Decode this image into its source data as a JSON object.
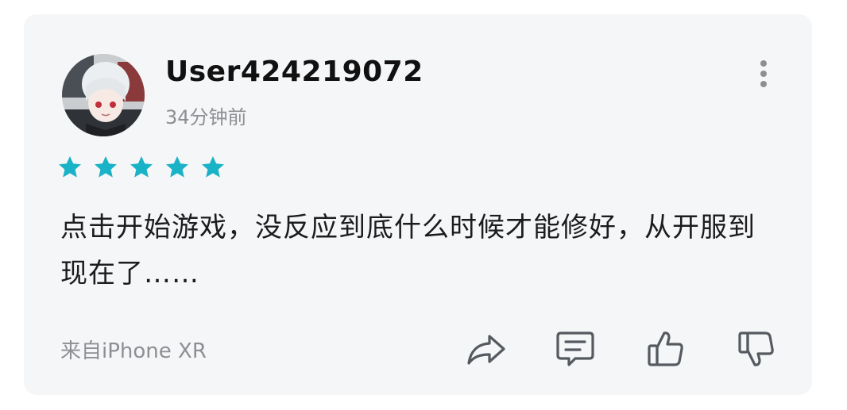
{
  "review": {
    "username": "User424219072",
    "time_ago": "34分钟前",
    "rating": 5,
    "rating_max": 5,
    "star_color": "#1ab2c6",
    "text": "点击开始游戏，没反应到底什么时候才能修好，从开服到现在了……",
    "source": "来自iPhone XR"
  },
  "icons": {
    "more": "more-vertical-icon",
    "share": "share-arrow-icon",
    "comment": "comment-icon",
    "like": "thumbs-up-icon",
    "dislike": "thumbs-down-icon"
  }
}
